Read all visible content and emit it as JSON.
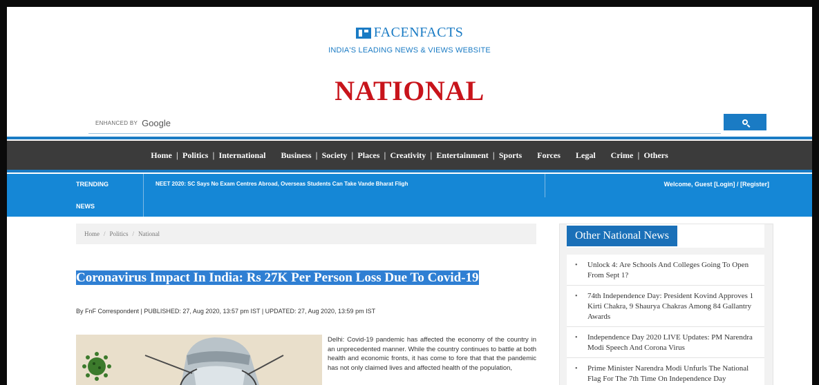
{
  "header": {
    "logo_text": "FACENFACTS",
    "tagline": "INDIA'S LEADING NEWS & VIEWS WEBSITE",
    "section_title": "NATIONAL"
  },
  "search": {
    "enhanced_by": "ENHANCED BY",
    "provider": "Google"
  },
  "nav": {
    "items": [
      "Home",
      "Politics",
      "International",
      "Business",
      "Society",
      "Places",
      "Creativity",
      "Entertainment",
      "Sports",
      "Forces",
      "Legal",
      "Crime",
      "Others"
    ]
  },
  "trending": {
    "label_line1": "TRENDING",
    "label_line2": "NEWS",
    "headline": "NEET 2020: SC Says No Exam Centres Abroad, Overseas Students Can Take Vande Bharat Fligh",
    "welcome": "Welcome, Guest [Login] / [Register]"
  },
  "breadcrumb": [
    "Home",
    "Politics",
    "National"
  ],
  "article": {
    "title": "Coronavirus Impact In India: Rs 27K Per Person Loss Due To Covid-19",
    "byline": "By FnF Correspondent | PUBLISHED: 27, Aug 2020, 13:57 pm IST | UPDATED: 27, Aug 2020, 13:59 pm IST",
    "body": "Delhi: Covid-19 pandemic has affected the economy of the country in an unprecedented manner. While the country continues to battle at both health and economic fronts, it has come to fore that that the pandemic has not only claimed lives and affected health of the population,"
  },
  "sidebar": {
    "heading": "Other National News",
    "items": [
      "Unlock 4: Are Schools And Colleges Going To Open From Sept 1?",
      "74th Independence Day: President Kovind Approves 1 Kirti Chakra, 9 Shaurya Chakras Among 84 Gallantry Awards",
      "Independence Day 2020 LIVE Updates: PM Narendra Modi Speech And Corona Virus",
      "Prime Minister Narendra Modi Unfurls The National Flag For The 7th Time On Independence Day"
    ]
  }
}
